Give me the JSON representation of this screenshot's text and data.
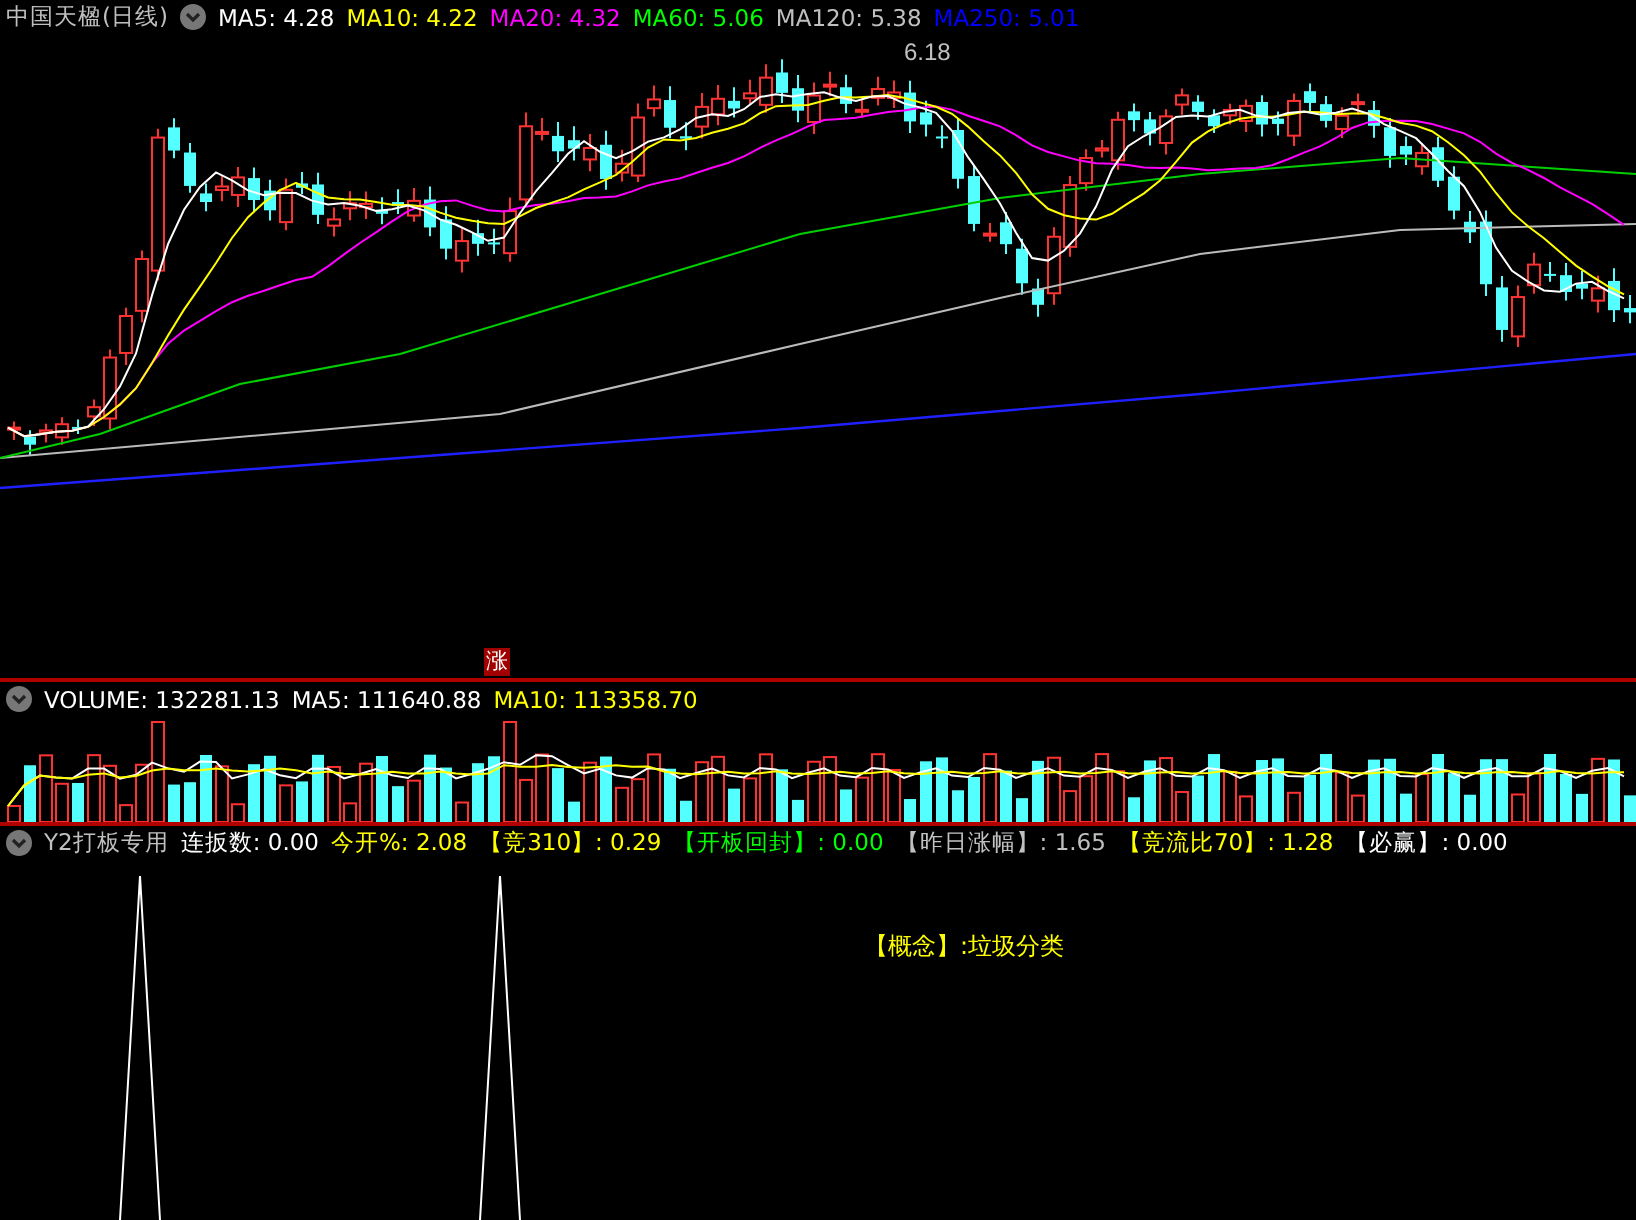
{
  "main_panel": {
    "title": "中国天楹(日线)",
    "indicators": [
      {
        "text": "MA5: 4.28",
        "color": "#ffffff"
      },
      {
        "text": "MA10: 4.22",
        "color": "#ffff00"
      },
      {
        "text": "MA20: 4.32",
        "color": "#ff00ff"
      },
      {
        "text": "MA60: 5.06",
        "color": "#00ff00"
      },
      {
        "text": "MA120: 5.38",
        "color": "#c0c0c0"
      },
      {
        "text": "MA250: 5.01",
        "color": "#0000ff"
      }
    ],
    "peak_label": "6.18",
    "badge": "涨"
  },
  "volume_panel": {
    "indicators": [
      {
        "text": "VOLUME: 132281.13",
        "color": "#ffffff"
      },
      {
        "text": "MA5: 111640.88",
        "color": "#ffffff"
      },
      {
        "text": "MA10: 113358.70",
        "color": "#ffff00"
      }
    ]
  },
  "signal_panel": {
    "title": "Y2打板专用",
    "indicators": [
      {
        "text": "连扳数: 0.00",
        "color": "#ffffff"
      },
      {
        "text": "今开%: 2.08",
        "color": "#ffff00"
      },
      {
        "text": "【竞310】: 0.29",
        "color": "#ffff00"
      },
      {
        "text": "【开板回封】: 0.00",
        "color": "#00ff00"
      },
      {
        "text": "【昨日涨幅】: 1.65",
        "color": "#c0c0c0"
      },
      {
        "text": "【竞流比70】: 1.28",
        "color": "#ffff00"
      },
      {
        "text": "【必赢】: 0.00",
        "color": "#ffffff"
      }
    ],
    "note": "【概念】:垃圾分类"
  }
}
